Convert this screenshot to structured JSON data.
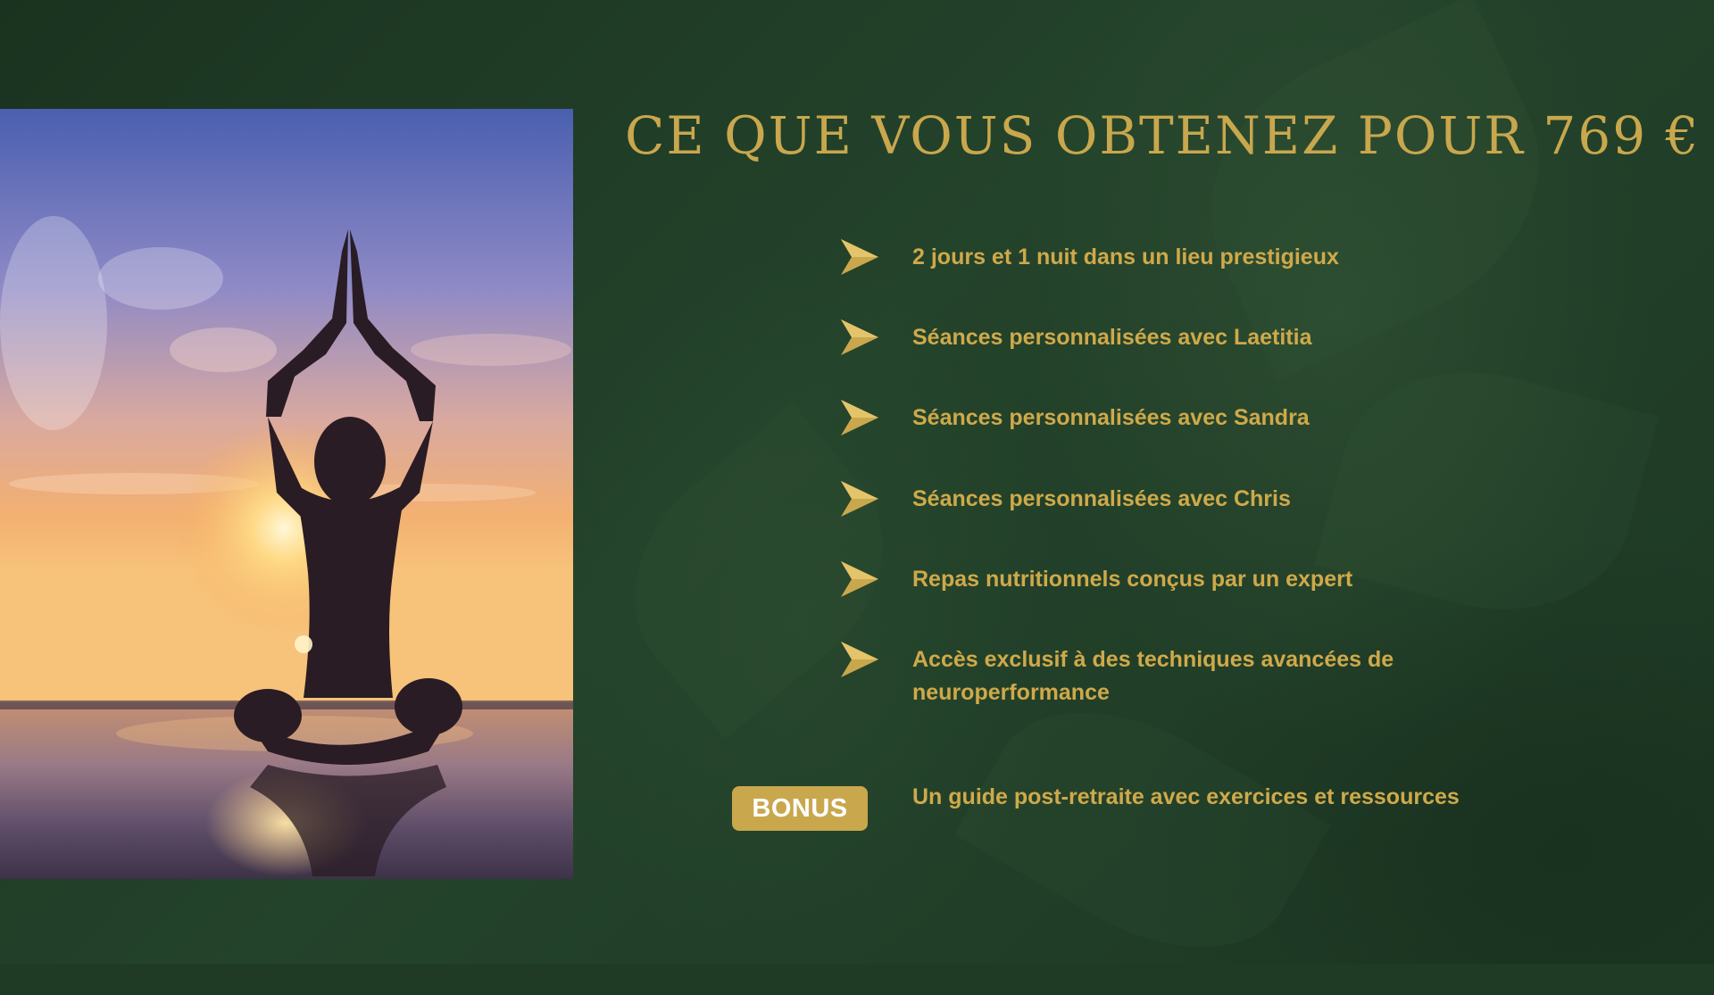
{
  "title": "CE QUE VOUS OBTENEZ POUR 769 €",
  "benefits": [
    {
      "text": "2 jours et 1 nuit dans un lieu prestigieux"
    },
    {
      "text": "Séances personnalisées avec Laetitia"
    },
    {
      "text": "Séances personnalisées avec Sandra"
    },
    {
      "text": "Séances personnalisées avec Chris"
    },
    {
      "text": "Repas nutritionnels conçus par un expert"
    },
    {
      "text": "Accès exclusif à des techniques avancées de neuroperformance"
    }
  ],
  "bonus": {
    "label": "BONUS",
    "text": "Un guide post-retraite avec exercices et ressources"
  },
  "colors": {
    "background": "#1f3a25",
    "accent_gold": "#c9a74d",
    "text_gold": "#cfa94a"
  },
  "icons": {
    "bullet": "gold-arrow-icon"
  }
}
